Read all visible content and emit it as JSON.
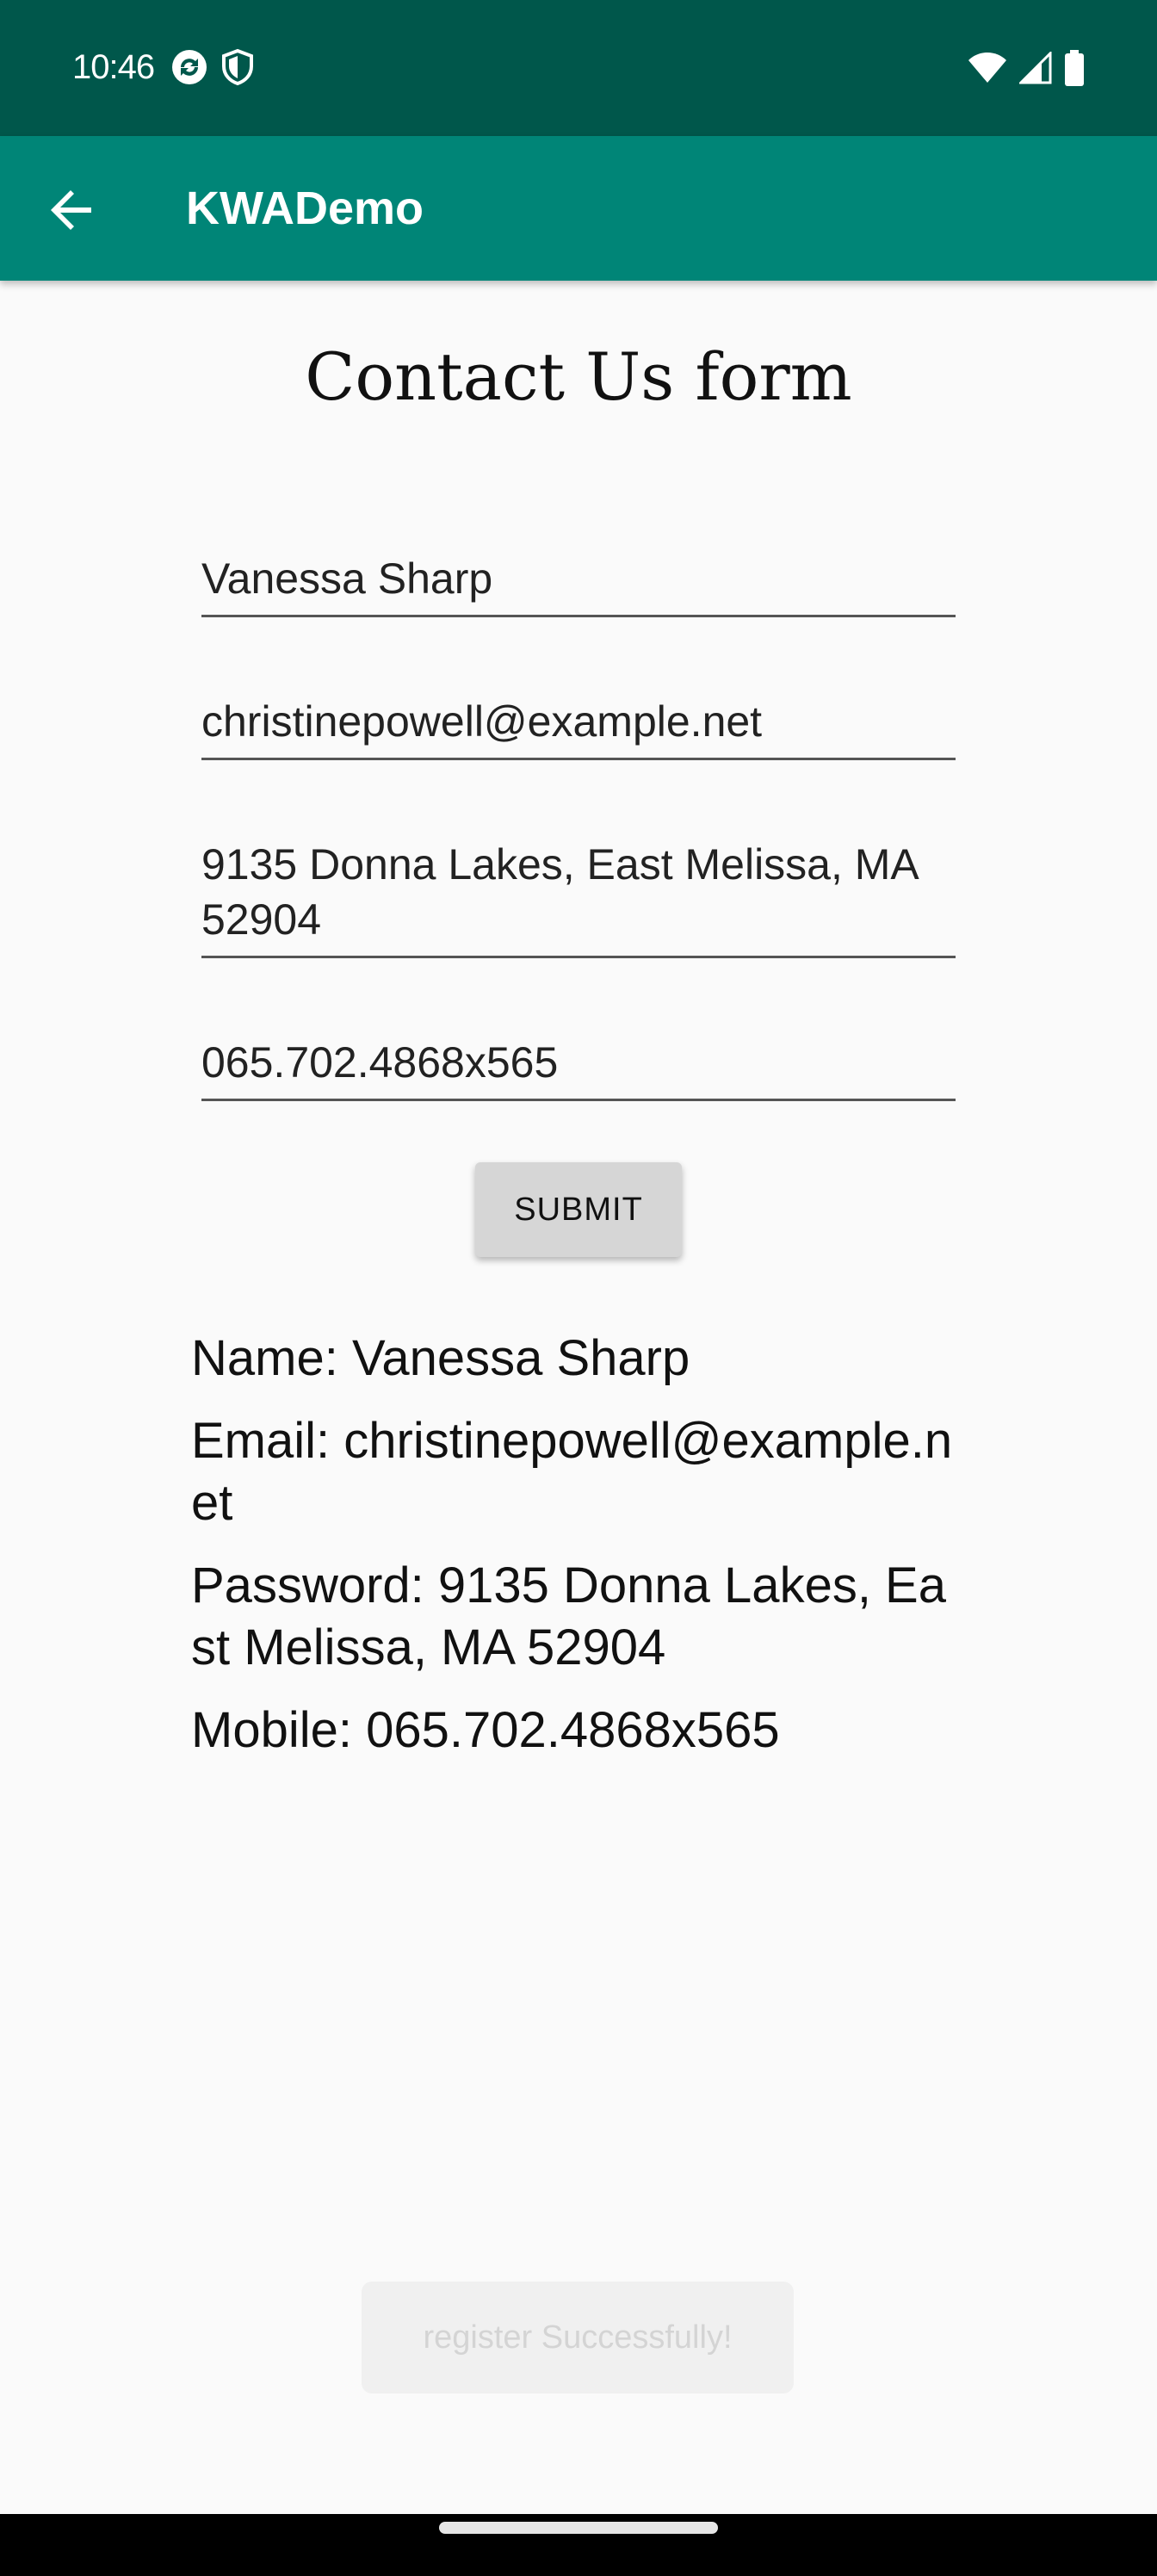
{
  "status_bar": {
    "time": "10:46",
    "left_icons": [
      "sync-icon",
      "shield-icon"
    ],
    "right_icons": [
      "wifi-icon",
      "signal-icon",
      "battery-icon"
    ]
  },
  "app_bar": {
    "title": "KWADemo",
    "back_icon": "arrow-back-icon",
    "color": "#008577",
    "status_color": "#00574b"
  },
  "form": {
    "title": "Contact Us form",
    "name_value": "Vanessa Sharp",
    "email_value": "christinepowell@example.net",
    "address_value": "9135 Donna Lakes, East Melissa, MA 52904",
    "mobile_value": "065.702.4868x565",
    "submit_label": "SUBMIT"
  },
  "results": {
    "name": "Name: Vanessa Sharp",
    "email": "Email: christinepowell@example.net",
    "password": "Password: 9135 Donna Lakes, East Melissa, MA 52904",
    "mobile": "Mobile: 065.702.4868x565"
  },
  "toast": {
    "message": "register Successfully!"
  }
}
